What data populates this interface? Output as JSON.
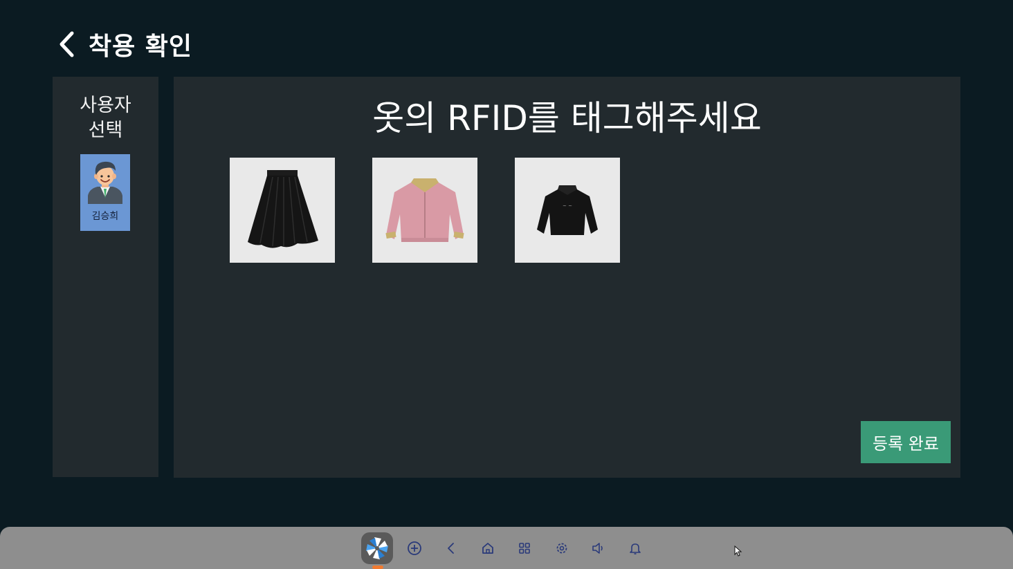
{
  "header": {
    "title": "착용 확인",
    "back_icon": "chevron-left-icon"
  },
  "sidebar": {
    "title_line1": "사용자",
    "title_line2": "선택",
    "users": [
      {
        "name": "김승희",
        "avatar_icon": "person-avatar-icon"
      }
    ]
  },
  "main": {
    "prompt": "옷의 RFID를 태그해주세요",
    "items": [
      {
        "icon": "black-pleated-skirt-image"
      },
      {
        "icon": "pink-jacket-image"
      },
      {
        "icon": "black-jacket-image"
      }
    ],
    "complete_button": "등록 완료"
  },
  "taskbar": {
    "icons": [
      "launcher-icon",
      "add-circle-icon",
      "back-arrow-icon",
      "home-icon",
      "apps-grid-icon",
      "settings-gear-icon",
      "volume-icon",
      "bell-icon"
    ]
  },
  "colors": {
    "background": "#0b1b22",
    "panel": "#222a2e",
    "user_card": "#6b97d4",
    "accent_button": "#3a9a77",
    "taskbar": "#8e8e8e",
    "launcher_dot": "#f07a30"
  }
}
